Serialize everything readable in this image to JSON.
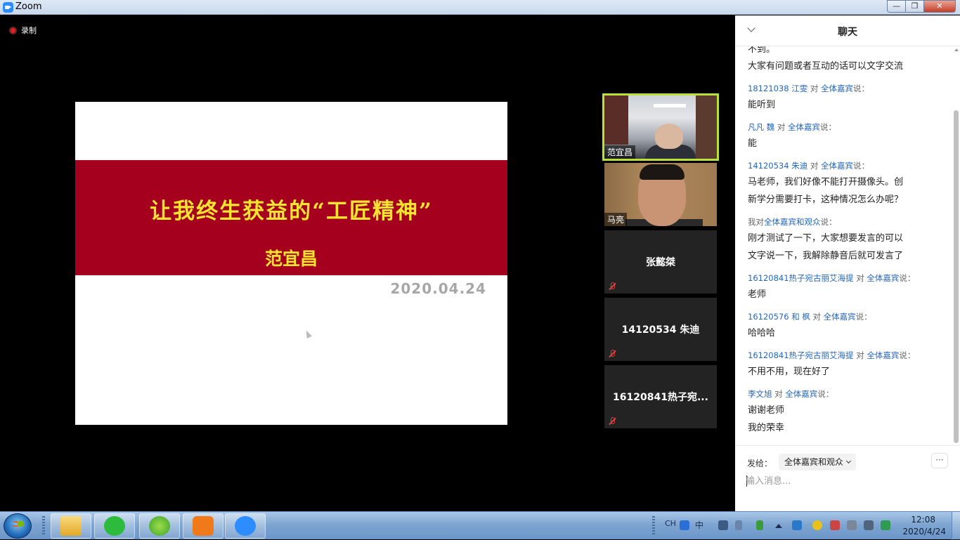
{
  "window": {
    "title": "Zoom",
    "minimize_label": "—",
    "restore_label": "❐",
    "close_label": "✕"
  },
  "recording": {
    "label": "录制"
  },
  "slide": {
    "title": "让我终生获益的“工匠精神”",
    "author": "范宜昌",
    "date": "2020.04.24"
  },
  "participants": [
    {
      "name": "范宜昌",
      "video": true,
      "active": true
    },
    {
      "name": "马亮",
      "video": true,
      "active": false
    },
    {
      "name": "张懿桀",
      "video": false,
      "muted": true
    },
    {
      "name": "14120534 朱迪",
      "video": false,
      "muted": true
    },
    {
      "name": "16120841热子宛...",
      "video": false,
      "muted": true
    }
  ],
  "chat": {
    "title": "聊天",
    "to_word": "对",
    "said_word": "说：",
    "messages": [
      {
        "text": "不到。"
      },
      {
        "text": "大家有问题或者互动的话可以文字交流"
      },
      {
        "sender": "18121038 江雯",
        "target": "全体嘉宾",
        "lines": [
          "能听到"
        ]
      },
      {
        "sender": "凡凡 魏",
        "target": "全体嘉宾",
        "lines": [
          "能"
        ]
      },
      {
        "sender": "14120534 朱迪",
        "target": "全体嘉宾",
        "lines": [
          "马老师，我们好像不能打开摄像头。创",
          "新学分需要打卡，这种情况怎么办呢？"
        ]
      },
      {
        "sender": "我",
        "target": "全体嘉宾和观众",
        "lines": [
          "刚才测试了一下，大家想要发言的可以",
          "文字说一下，我解除静音后就可发言了"
        ]
      },
      {
        "sender": "16120841热子宛古丽艾海提",
        "target": "全体嘉宾",
        "lines": [
          "老师"
        ]
      },
      {
        "sender": "16120576 和 枫",
        "target": "全体嘉宾",
        "lines": [
          "哈哈哈"
        ]
      },
      {
        "sender": "16120841热子宛古丽艾海提",
        "target": "全体嘉宾",
        "lines": [
          "不用不用，现在好了"
        ]
      },
      {
        "sender": "李文旭",
        "target": "全体嘉宾",
        "lines": [
          "谢谢老师",
          "我的荣幸"
        ]
      }
    ],
    "send_to_label": "发给：",
    "recipient": "全体嘉宾和观众",
    "more_label": "···",
    "input_placeholder": "输入消息..."
  },
  "taskbar": {
    "apps": [
      "folder-icon",
      "wechat-icon",
      "ie-icon",
      "pdf-icon",
      "zoom-icon"
    ],
    "tray": {
      "language": "CH",
      "ime": "中"
    },
    "clock": {
      "time": "12:08",
      "date": "2020/4/24"
    }
  }
}
